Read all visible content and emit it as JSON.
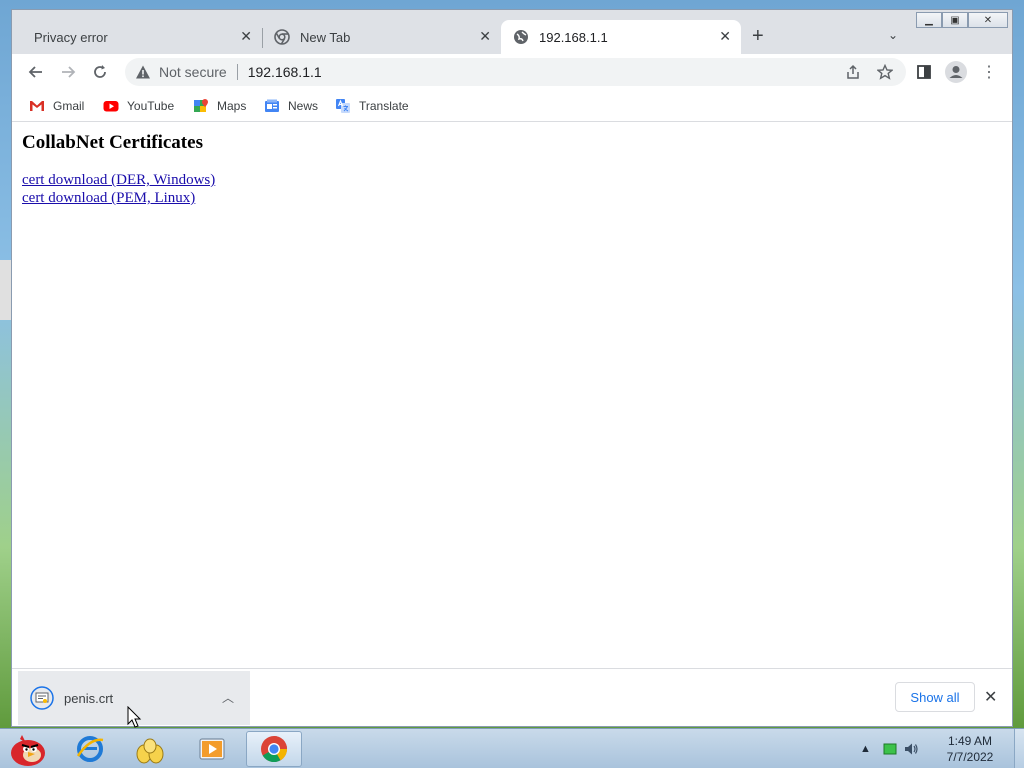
{
  "tabs": [
    {
      "title": "Privacy error",
      "active": false
    },
    {
      "title": "New Tab",
      "active": false
    },
    {
      "title": "192.168.1.1",
      "active": true
    }
  ],
  "toolbar": {
    "security_label": "Not secure",
    "url": "192.168.1.1"
  },
  "bookmarks": [
    {
      "label": "Gmail"
    },
    {
      "label": "YouTube"
    },
    {
      "label": "Maps"
    },
    {
      "label": "News"
    },
    {
      "label": "Translate"
    }
  ],
  "page": {
    "heading": "CollabNet Certificates",
    "links": [
      {
        "label": "cert download (DER, Windows)"
      },
      {
        "label": "cert download (PEM, Linux)"
      }
    ]
  },
  "downloads": {
    "file_name": "penis.crt",
    "show_all_label": "Show all"
  },
  "taskbar": {
    "time": "1:49 AM",
    "date": "7/7/2022"
  },
  "colors": {
    "link": "#1a0dab",
    "accent": "#1a73e8",
    "tabstrip": "#dee1e6"
  }
}
